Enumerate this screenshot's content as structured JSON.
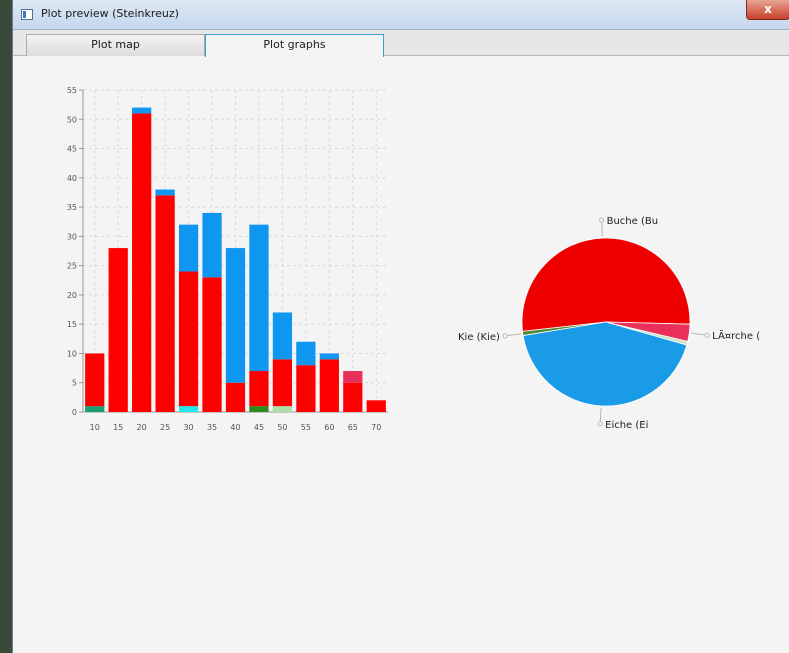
{
  "window": {
    "title": "Plot preview (Steinkreuz)",
    "close_label": "x"
  },
  "tabs": [
    {
      "label": "Plot map",
      "active": false
    },
    {
      "label": "Plot graphs",
      "active": true
    }
  ],
  "chart_data": [
    {
      "type": "bar",
      "stacked": true,
      "categories": [
        "10",
        "15",
        "20",
        "25",
        "30",
        "35",
        "40",
        "45",
        "50",
        "55",
        "60",
        "65",
        "70"
      ],
      "ylim": [
        0,
        55
      ],
      "yticks": [
        0,
        5,
        10,
        15,
        20,
        25,
        30,
        35,
        40,
        45,
        50,
        55
      ],
      "grid": true,
      "series": [
        {
          "color": "#1a9e74",
          "values": [
            1,
            0,
            0,
            0,
            0,
            0,
            0,
            0,
            0,
            0,
            0,
            0,
            0
          ]
        },
        {
          "color": "#22e8e8",
          "values": [
            0,
            0,
            0,
            0,
            1,
            0,
            0,
            0,
            0,
            0,
            0,
            0,
            0
          ]
        },
        {
          "color": "#2a8a1a",
          "values": [
            0,
            0,
            0,
            0,
            0,
            0,
            0,
            1,
            0,
            0,
            0,
            0,
            0
          ]
        },
        {
          "color": "#a8e0a8",
          "values": [
            0,
            0,
            0,
            0,
            0,
            0,
            0,
            0,
            1,
            0,
            0,
            0,
            0
          ]
        },
        {
          "color": "#ff0000",
          "values": [
            9,
            28,
            51,
            37,
            23,
            23,
            5,
            6,
            8,
            8,
            9,
            5,
            2
          ]
        },
        {
          "color": "#e8305a",
          "values": [
            0,
            0,
            0,
            0,
            0,
            0,
            0,
            0,
            0,
            0,
            0,
            2,
            0
          ]
        },
        {
          "color": "#0f96f0",
          "values": [
            0,
            0,
            1,
            1,
            8,
            11,
            23,
            25,
            8,
            4,
            1,
            0,
            0
          ]
        }
      ]
    },
    {
      "type": "pie",
      "slices": [
        {
          "label": "Buche (Bu",
          "value": 52.2,
          "color": "#ee0000"
        },
        {
          "label": "Kie (Kie)",
          "value": 0.8,
          "color": "#4e8a2c"
        },
        {
          "label": "Eiche (Ei",
          "value": 43.0,
          "color": "#1a9be8"
        },
        {
          "label": "",
          "value": 0.7,
          "color": "#c7e3c8"
        },
        {
          "label": "LÃ¤rche (",
          "value": 3.3,
          "color": "#e8305a"
        }
      ]
    }
  ]
}
